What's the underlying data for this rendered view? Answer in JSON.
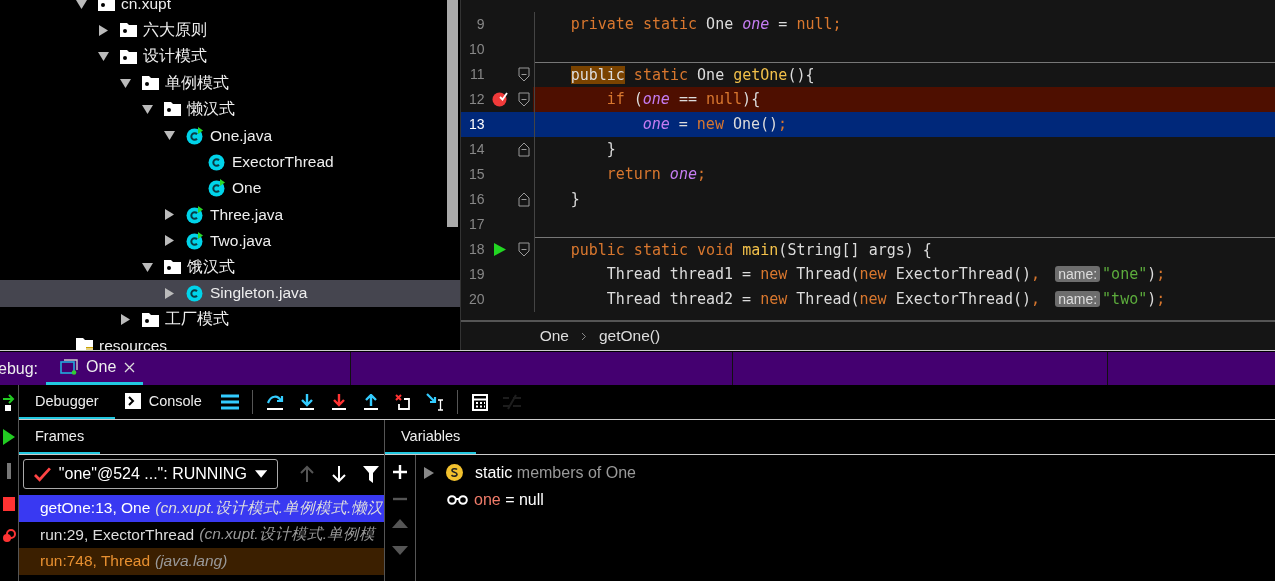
{
  "project_tree": {
    "scrollbar": true,
    "items": [
      {
        "children": [
          {
            "label": "cn.xupt",
            "kind": "package",
            "expanded": true,
            "selected": false,
            "children": [
              {
                "label": "六大原则",
                "kind": "package",
                "expanded": false,
                "selected": false
              },
              {
                "label": "设计模式",
                "kind": "package",
                "expanded": true,
                "selected": false,
                "children": [
                  {
                    "label": "单例模式",
                    "kind": "package",
                    "expanded": true,
                    "selected": false,
                    "children": [
                      {
                        "label": "懒汉式",
                        "kind": "package",
                        "expanded": true,
                        "selected": false,
                        "children": [
                          {
                            "label": "One.java",
                            "kind": "runnable-class",
                            "expanded": true,
                            "selected": false,
                            "children": [
                              {
                                "label": "ExectorThread",
                                "kind": "class",
                                "selected": false
                              },
                              {
                                "label": "One",
                                "kind": "runnable-class",
                                "selected": false
                              }
                            ]
                          },
                          {
                            "label": "Three.java",
                            "kind": "runnable-class",
                            "expanded": false,
                            "selected": false
                          },
                          {
                            "label": "Two.java",
                            "kind": "runnable-class",
                            "expanded": false,
                            "selected": false
                          }
                        ]
                      },
                      {
                        "label": "饿汉式",
                        "kind": "package",
                        "expanded": true,
                        "selected": false,
                        "children": [
                          {
                            "label": "Singleton.java",
                            "kind": "class",
                            "expanded": false,
                            "selected": true
                          }
                        ]
                      }
                    ]
                  },
                  {
                    "label": "工厂模式",
                    "kind": "package",
                    "expanded": false,
                    "selected": false
                  }
                ]
              }
            ]
          }
        ]
      },
      {
        "label": "resources",
        "kind": "resources",
        "selected": false
      }
    ]
  },
  "editor": {
    "lines": [
      {
        "number": "9",
        "kind": "normal",
        "separator": false,
        "tokens": [
          {
            "kind": "kw",
            "text": "private static "
          },
          {
            "kind": "id",
            "text": "One "
          },
          {
            "kind": "field",
            "text": "one"
          },
          {
            "kind": "id",
            "text": " = "
          },
          {
            "kind": "kw",
            "text": "null;"
          }
        ]
      },
      {
        "number": "10",
        "kind": "normal",
        "separator": false
      },
      {
        "number": "11",
        "kind": "normal",
        "separator": true,
        "fold_marker": {
          "kind": "start"
        },
        "tokens": [
          {
            "kind": "kw-marked",
            "text": "public"
          },
          {
            "kind": "kw",
            "text": " static "
          },
          {
            "kind": "id",
            "text": "One "
          },
          {
            "kind": "method",
            "text": "getOne"
          },
          {
            "kind": "id",
            "text": "(){"
          }
        ]
      },
      {
        "number": "12",
        "kind": "breakpoint",
        "separator": false,
        "gutter_icon": {
          "kind": "breakpoint"
        },
        "fold_marker": {
          "kind": "start"
        },
        "tokens": [
          {
            "kind": "kw",
            "text": "if "
          },
          {
            "kind": "id",
            "text": "("
          },
          {
            "kind": "field",
            "text": "one"
          },
          {
            "kind": "id",
            "text": " == "
          },
          {
            "kind": "kw",
            "text": "null"
          },
          {
            "kind": "id",
            "text": "){"
          }
        ]
      },
      {
        "number": "13",
        "kind": "execution",
        "separator": false,
        "tokens": [
          {
            "kind": "field",
            "text": "one"
          },
          {
            "kind": "id",
            "text": " = "
          },
          {
            "kind": "kw",
            "text": "new "
          },
          {
            "kind": "id",
            "text": "One()"
          },
          {
            "kind": "kw",
            "text": ";"
          }
        ]
      },
      {
        "number": "14",
        "kind": "normal",
        "separator": false,
        "fold_marker": {
          "kind": "end"
        },
        "tokens": [
          {
            "kind": "id",
            "text": "}"
          }
        ]
      },
      {
        "number": "15",
        "kind": "normal",
        "separator": false,
        "tokens": [
          {
            "kind": "kw",
            "text": "return "
          },
          {
            "kind": "field",
            "text": "one"
          },
          {
            "kind": "kw",
            "text": ";"
          }
        ]
      },
      {
        "number": "16",
        "kind": "normal",
        "separator": false,
        "fold_marker": {
          "kind": "end"
        },
        "tokens": [
          {
            "kind": "id",
            "text": "}"
          }
        ]
      },
      {
        "number": "17",
        "kind": "normal",
        "separator": false
      },
      {
        "number": "18",
        "kind": "normal",
        "separator": true,
        "gutter_icon": {
          "kind": "run"
        },
        "fold_marker": {
          "kind": "start"
        },
        "tokens": [
          {
            "kind": "kw",
            "text": "public static void "
          },
          {
            "kind": "method",
            "text": "main"
          },
          {
            "kind": "id",
            "text": "(String[] args) {"
          }
        ]
      },
      {
        "number": "19",
        "kind": "normal",
        "separator": false,
        "tokens": [
          {
            "kind": "id",
            "text": "Thread thread1 = "
          },
          {
            "kind": "kw",
            "text": "new "
          },
          {
            "kind": "id",
            "text": "Thread("
          },
          {
            "kind": "kw",
            "text": "new "
          },
          {
            "kind": "id",
            "text": "ExectorThread()"
          },
          {
            "kind": "kw",
            "text": ", "
          },
          {
            "kind": "hint",
            "text": "name:"
          },
          {
            "kind": "str",
            "text": "\"one\""
          },
          {
            "kind": "id",
            "text": ")"
          },
          {
            "kind": "kw",
            "text": ";"
          }
        ]
      },
      {
        "number": "20",
        "kind": "normal",
        "separator": false,
        "tokens": [
          {
            "kind": "id",
            "text": "Thread thread2 = "
          },
          {
            "kind": "kw",
            "text": "new "
          },
          {
            "kind": "id",
            "text": "Thread("
          },
          {
            "kind": "kw",
            "text": "new "
          },
          {
            "kind": "id",
            "text": "ExectorThread()"
          },
          {
            "kind": "kw",
            "text": ", "
          },
          {
            "kind": "hint",
            "text": "name:"
          },
          {
            "kind": "str",
            "text": "\"two\""
          },
          {
            "kind": "id",
            "text": ")"
          },
          {
            "kind": "kw",
            "text": ";"
          }
        ]
      }
    ],
    "breadcrumbs": [
      "One",
      "getOne()"
    ]
  },
  "debug": {
    "label": "ebug:",
    "tabs": [
      {
        "label": "One",
        "selected": true
      }
    ],
    "side_buttons": [
      {
        "kind": "rerun"
      },
      {
        "kind": "resume"
      },
      {
        "kind": "pause"
      },
      {
        "kind": "stop"
      },
      {
        "kind": "breakpoints"
      }
    ],
    "view_tabs": [
      {
        "label": "Debugger",
        "kind": "plain",
        "selected": true
      },
      {
        "label": "Console",
        "kind": "console",
        "selected": false
      }
    ],
    "toolbar_buttons": [
      {
        "kind": "layout",
        "disabled": false
      },
      {
        "kind": "step-over",
        "disabled": false
      },
      {
        "kind": "step-into",
        "disabled": false
      },
      {
        "kind": "force-step-into",
        "disabled": false
      },
      {
        "kind": "step-out",
        "disabled": false
      },
      {
        "kind": "drop-frame",
        "disabled": false
      },
      {
        "kind": "run-to-cursor",
        "disabled": false
      },
      {
        "kind": "evaluate",
        "disabled": false
      },
      {
        "kind": "trace",
        "disabled": true
      }
    ],
    "frames": {
      "title": "Frames",
      "thread": "\"one\"@524 ...\": RUNNING",
      "nav": [
        {
          "kind": "up",
          "disabled": true
        },
        {
          "kind": "down",
          "disabled": false
        },
        {
          "kind": "filter",
          "disabled": false
        }
      ],
      "items": [
        {
          "method": "getOne:13, One",
          "package": "(cn.xupt.设计模式.单例模式.懒汉",
          "kind": "app",
          "selected": true
        },
        {
          "method": "run:29, ExectorThread",
          "package": "(cn.xupt.设计模式.单例模",
          "kind": "app",
          "selected": false
        },
        {
          "method": "run:748, Thread",
          "package": "(java.lang)",
          "kind": "library",
          "selected": false
        }
      ]
    },
    "variables": {
      "title": "Variables",
      "tools": [
        {
          "kind": "add",
          "disabled": false
        },
        {
          "kind": "remove",
          "disabled": true
        },
        {
          "kind": "up",
          "disabled": true
        },
        {
          "kind": "down",
          "disabled": true
        }
      ],
      "items": [
        {
          "kind": "static",
          "name": "static",
          "desc": "members of One",
          "expanded": false
        },
        {
          "kind": "watch",
          "name": "one",
          "sep": "=",
          "value": "null"
        }
      ]
    }
  }
}
